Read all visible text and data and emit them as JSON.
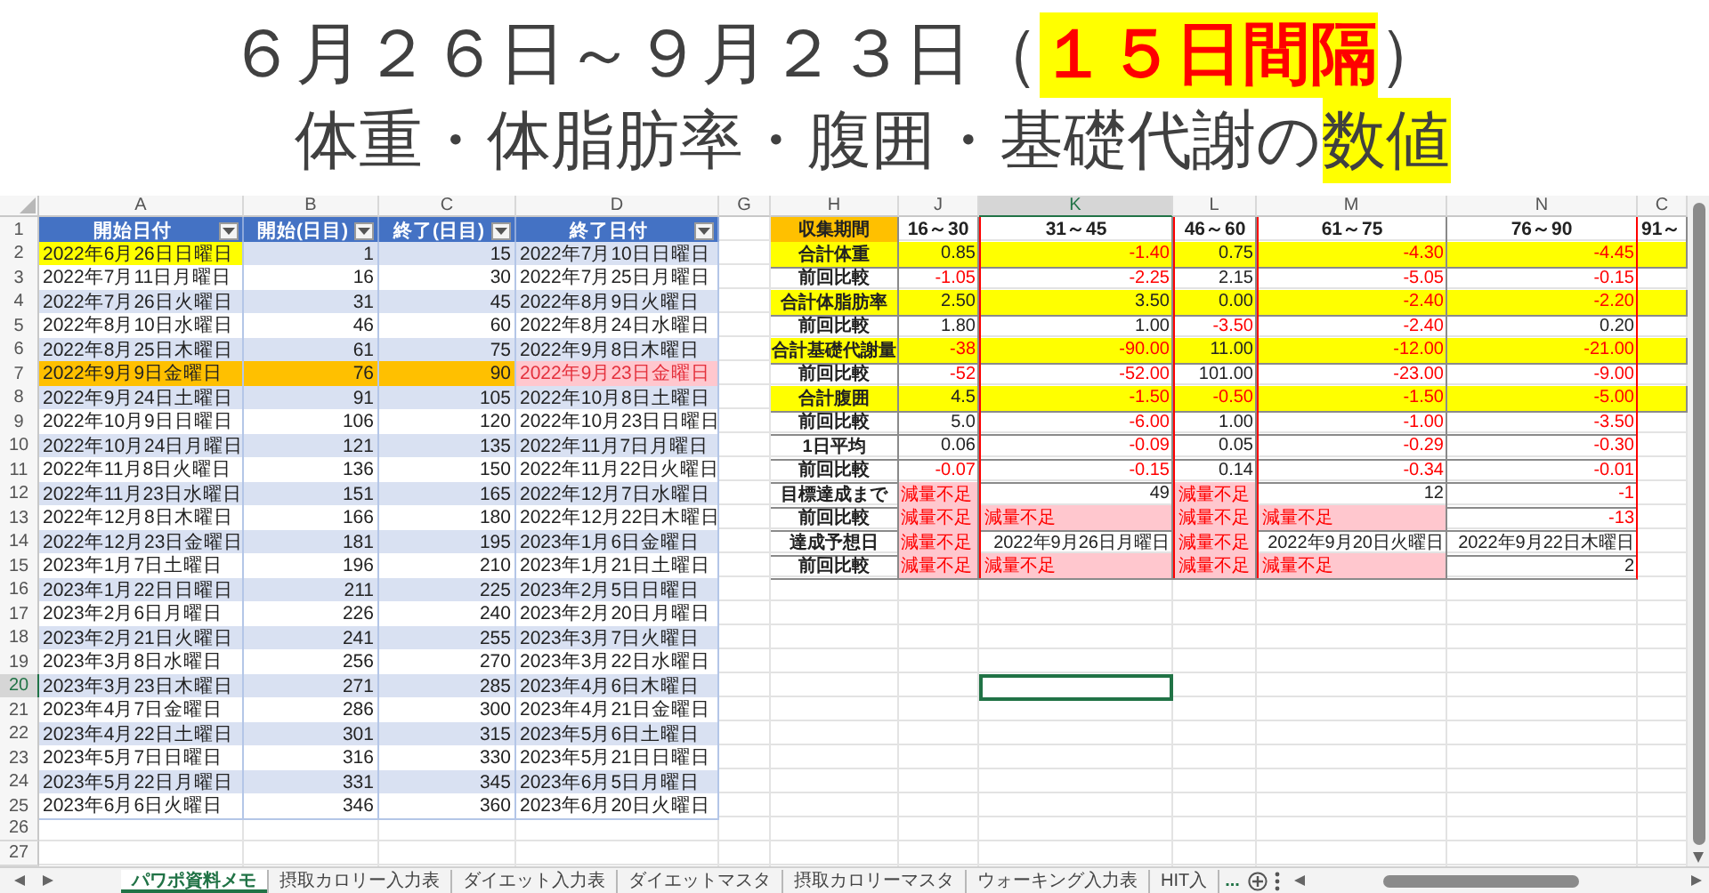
{
  "title": {
    "lines": [
      [
        {
          "text": "６月２６日～９月２３日（",
          "highlighted": false
        },
        {
          "text": "１５日間隔",
          "highlighted": true
        },
        {
          "text": "）",
          "highlighted": false
        }
      ],
      [
        {
          "text": "体重・体脂肪率・腹囲・基礎代謝の",
          "highlighted": false
        },
        {
          "text": "数値",
          "highlighted": true
        }
      ]
    ]
  },
  "sheet": {
    "column_headers": [
      {
        "label": "A",
        "selected": false
      },
      {
        "label": "B",
        "selected": false
      },
      {
        "label": "C",
        "selected": false
      },
      {
        "label": "D",
        "selected": false
      },
      {
        "label": "G",
        "selected": false
      },
      {
        "label": "H",
        "selected": false
      },
      {
        "label": "J",
        "selected": false
      },
      {
        "label": "K",
        "selected": true
      },
      {
        "label": "L",
        "selected": false
      },
      {
        "label": "M",
        "selected": false
      },
      {
        "label": "N",
        "selected": false
      },
      {
        "label": "C",
        "selected": false
      }
    ],
    "row_numbers": [
      {
        "label": "1",
        "selected": false
      },
      {
        "label": "2",
        "selected": false
      },
      {
        "label": "3",
        "selected": false
      },
      {
        "label": "4",
        "selected": false
      },
      {
        "label": "5",
        "selected": false
      },
      {
        "label": "6",
        "selected": false
      },
      {
        "label": "7",
        "selected": false
      },
      {
        "label": "8",
        "selected": false
      },
      {
        "label": "9",
        "selected": false
      },
      {
        "label": "10",
        "selected": false
      },
      {
        "label": "11",
        "selected": false
      },
      {
        "label": "12",
        "selected": false
      },
      {
        "label": "13",
        "selected": false
      },
      {
        "label": "14",
        "selected": false
      },
      {
        "label": "15",
        "selected": false
      },
      {
        "label": "16",
        "selected": false
      },
      {
        "label": "17",
        "selected": false
      },
      {
        "label": "18",
        "selected": false
      },
      {
        "label": "19",
        "selected": false
      },
      {
        "label": "20",
        "selected": true
      },
      {
        "label": "21",
        "selected": false
      },
      {
        "label": "22",
        "selected": false
      },
      {
        "label": "23",
        "selected": false
      },
      {
        "label": "24",
        "selected": false
      },
      {
        "label": "25",
        "selected": false
      },
      {
        "label": "26",
        "selected": false
      },
      {
        "label": "27",
        "selected": false
      }
    ]
  },
  "left_table": {
    "headers": [
      "開始日付",
      "開始(日目)",
      "終了(日目)",
      "終了日付"
    ],
    "rows": [
      {
        "kind": "first",
        "cells": [
          "2022年6月26日日曜日",
          "1",
          "15",
          "2022年7月10日日曜日"
        ]
      },
      {
        "kind": "normal",
        "cells": [
          "2022年7月11日月曜日",
          "16",
          "30",
          "2022年7月25日月曜日"
        ]
      },
      {
        "kind": "normal",
        "cells": [
          "2022年7月26日火曜日",
          "31",
          "45",
          "2022年8月9日火曜日"
        ]
      },
      {
        "kind": "normal",
        "cells": [
          "2022年8月10日水曜日",
          "46",
          "60",
          "2022年8月24日水曜日"
        ]
      },
      {
        "kind": "normal",
        "cells": [
          "2022年8月25日木曜日",
          "61",
          "75",
          "2022年9月8日木曜日"
        ]
      },
      {
        "kind": "current",
        "cells": [
          "2022年9月9日金曜日",
          "76",
          "90",
          "2022年9月23日金曜日"
        ]
      },
      {
        "kind": "normal",
        "cells": [
          "2022年9月24日土曜日",
          "91",
          "105",
          "2022年10月8日土曜日"
        ]
      },
      {
        "kind": "normal",
        "cells": [
          "2022年10月9日日曜日",
          "106",
          "120",
          "2022年10月23日日曜日"
        ]
      },
      {
        "kind": "normal",
        "cells": [
          "2022年10月24日月曜日",
          "121",
          "135",
          "2022年11月7日月曜日"
        ]
      },
      {
        "kind": "normal",
        "cells": [
          "2022年11月8日火曜日",
          "136",
          "150",
          "2022年11月22日火曜日"
        ]
      },
      {
        "kind": "normal",
        "cells": [
          "2022年11月23日水曜日",
          "151",
          "165",
          "2022年12月7日水曜日"
        ]
      },
      {
        "kind": "normal",
        "cells": [
          "2022年12月8日木曜日",
          "166",
          "180",
          "2022年12月22日木曜日"
        ]
      },
      {
        "kind": "normal",
        "cells": [
          "2022年12月23日金曜日",
          "181",
          "195",
          "2023年1月6日金曜日"
        ]
      },
      {
        "kind": "normal",
        "cells": [
          "2023年1月7日土曜日",
          "196",
          "210",
          "2023年1月21日土曜日"
        ]
      },
      {
        "kind": "normal",
        "cells": [
          "2023年1月22日日曜日",
          "211",
          "225",
          "2023年2月5日日曜日"
        ]
      },
      {
        "kind": "normal",
        "cells": [
          "2023年2月6日月曜日",
          "226",
          "240",
          "2023年2月20日月曜日"
        ]
      },
      {
        "kind": "normal",
        "cells": [
          "2023年2月21日火曜日",
          "241",
          "255",
          "2023年3月7日火曜日"
        ]
      },
      {
        "kind": "normal",
        "cells": [
          "2023年3月8日水曜日",
          "256",
          "270",
          "2023年3月22日水曜日"
        ]
      },
      {
        "kind": "normal",
        "cells": [
          "2023年3月23日木曜日",
          "271",
          "285",
          "2023年4月6日木曜日"
        ]
      },
      {
        "kind": "normal",
        "cells": [
          "2023年4月7日金曜日",
          "286",
          "300",
          "2023年4月21日金曜日"
        ]
      },
      {
        "kind": "normal",
        "cells": [
          "2023年4月22日土曜日",
          "301",
          "315",
          "2023年5月6日土曜日"
        ]
      },
      {
        "kind": "normal",
        "cells": [
          "2023年5月7日日曜日",
          "316",
          "330",
          "2023年5月21日日曜日"
        ]
      },
      {
        "kind": "normal",
        "cells": [
          "2023年5月22日月曜日",
          "331",
          "345",
          "2023年6月5日月曜日"
        ]
      },
      {
        "kind": "normal",
        "cells": [
          "2023年6月6日火曜日",
          "346",
          "360",
          "2023年6月20日火曜日"
        ]
      }
    ]
  },
  "right_table": {
    "corner_label": "収集期間",
    "periods": [
      "16～30",
      "31～45",
      "46～60",
      "61～75",
      "76～90",
      "91～"
    ],
    "rows": [
      {
        "label": "合計体重",
        "kind": "total",
        "cells": [
          {
            "text": "0.85",
            "kind": "value"
          },
          {
            "text": "-1.40",
            "kind": "negative"
          },
          {
            "text": "0.75",
            "kind": "value"
          },
          {
            "text": "-4.30",
            "kind": "negative"
          },
          {
            "text": "-4.45",
            "kind": "negative"
          }
        ]
      },
      {
        "label": "前回比較",
        "kind": "detail",
        "cells": [
          {
            "text": "-1.05",
            "kind": "negative"
          },
          {
            "text": "-2.25",
            "kind": "negative"
          },
          {
            "text": "2.15",
            "kind": "value"
          },
          {
            "text": "-5.05",
            "kind": "negative"
          },
          {
            "text": "-0.15",
            "kind": "negative"
          }
        ]
      },
      {
        "label": "合計体脂肪率",
        "kind": "total",
        "cells": [
          {
            "text": "2.50",
            "kind": "value"
          },
          {
            "text": "3.50",
            "kind": "value"
          },
          {
            "text": "0.00",
            "kind": "value"
          },
          {
            "text": "-2.40",
            "kind": "negative"
          },
          {
            "text": "-2.20",
            "kind": "negative"
          }
        ]
      },
      {
        "label": "前回比較",
        "kind": "detail",
        "cells": [
          {
            "text": "1.80",
            "kind": "value"
          },
          {
            "text": "1.00",
            "kind": "value"
          },
          {
            "text": "-3.50",
            "kind": "negative"
          },
          {
            "text": "-2.40",
            "kind": "negative"
          },
          {
            "text": "0.20",
            "kind": "value"
          }
        ]
      },
      {
        "label": "合計基礎代謝量",
        "kind": "total",
        "cells": [
          {
            "text": "-38",
            "kind": "negative"
          },
          {
            "text": "-90.00",
            "kind": "negative"
          },
          {
            "text": "11.00",
            "kind": "value"
          },
          {
            "text": "-12.00",
            "kind": "negative"
          },
          {
            "text": "-21.00",
            "kind": "negative"
          }
        ]
      },
      {
        "label": "前回比較",
        "kind": "detail",
        "cells": [
          {
            "text": "-52",
            "kind": "negative"
          },
          {
            "text": "-52.00",
            "kind": "negative"
          },
          {
            "text": "101.00",
            "kind": "value"
          },
          {
            "text": "-23.00",
            "kind": "negative"
          },
          {
            "text": "-9.00",
            "kind": "negative"
          }
        ]
      },
      {
        "label": "合計腹囲",
        "kind": "total",
        "cells": [
          {
            "text": "4.5",
            "kind": "value"
          },
          {
            "text": "-1.50",
            "kind": "negative"
          },
          {
            "text": "-0.50",
            "kind": "negative"
          },
          {
            "text": "-1.50",
            "kind": "negative"
          },
          {
            "text": "-5.00",
            "kind": "negative"
          }
        ]
      },
      {
        "label": "前回比較",
        "kind": "detail",
        "cells": [
          {
            "text": "5.0",
            "kind": "value"
          },
          {
            "text": "-6.00",
            "kind": "negative"
          },
          {
            "text": "1.00",
            "kind": "value"
          },
          {
            "text": "-1.00",
            "kind": "negative"
          },
          {
            "text": "-3.50",
            "kind": "negative"
          }
        ]
      },
      {
        "label": "1日平均",
        "kind": "detail",
        "cells": [
          {
            "text": "0.06",
            "kind": "value"
          },
          {
            "text": "-0.09",
            "kind": "negative"
          },
          {
            "text": "0.05",
            "kind": "value"
          },
          {
            "text": "-0.29",
            "kind": "negative"
          },
          {
            "text": "-0.30",
            "kind": "negative"
          }
        ]
      },
      {
        "label": "前回比較",
        "kind": "detail",
        "cells": [
          {
            "text": "-0.07",
            "kind": "negative"
          },
          {
            "text": "-0.15",
            "kind": "negative"
          },
          {
            "text": "0.14",
            "kind": "value"
          },
          {
            "text": "-0.34",
            "kind": "negative"
          },
          {
            "text": "-0.01",
            "kind": "negative"
          }
        ]
      },
      {
        "label": "目標達成まで",
        "kind": "detail",
        "cells": [
          {
            "text": "減量不足",
            "kind": "shortfall"
          },
          {
            "text": "49",
            "kind": "value"
          },
          {
            "text": "減量不足",
            "kind": "shortfall"
          },
          {
            "text": "12",
            "kind": "value"
          },
          {
            "text": "-1",
            "kind": "negative"
          }
        ]
      },
      {
        "label": "前回比較",
        "kind": "detail",
        "cells": [
          {
            "text": "減量不足",
            "kind": "shortfall"
          },
          {
            "text": "減量不足",
            "kind": "shortfall"
          },
          {
            "text": "減量不足",
            "kind": "shortfall"
          },
          {
            "text": "減量不足",
            "kind": "shortfall"
          },
          {
            "text": "-13",
            "kind": "negative"
          }
        ]
      },
      {
        "label": "達成予想日",
        "kind": "detail",
        "cells": [
          {
            "text": "減量不足",
            "kind": "shortfall"
          },
          {
            "text": "2022年9月26日月曜日",
            "kind": "value"
          },
          {
            "text": "減量不足",
            "kind": "shortfall"
          },
          {
            "text": "2022年9月20日火曜日",
            "kind": "value"
          },
          {
            "text": "2022年9月22日木曜日",
            "kind": "value"
          }
        ]
      },
      {
        "label": "前回比較",
        "kind": "detail",
        "cells": [
          {
            "text": "減量不足",
            "kind": "shortfall"
          },
          {
            "text": "減量不足",
            "kind": "shortfall"
          },
          {
            "text": "減量不足",
            "kind": "shortfall"
          },
          {
            "text": "減量不足",
            "kind": "shortfall"
          },
          {
            "text": "2",
            "kind": "value"
          }
        ]
      }
    ]
  },
  "sheet_tabs": [
    {
      "label": "パワポ資料メモ",
      "selected": true
    },
    {
      "label": "摂取カロリー入力表",
      "selected": false
    },
    {
      "label": "ダイエット入力表",
      "selected": false
    },
    {
      "label": "ダイエットマスタ",
      "selected": false
    },
    {
      "label": "摂取カロリーマスタ",
      "selected": false
    },
    {
      "label": "ウォーキング入力表",
      "selected": false
    },
    {
      "label": "HIT入",
      "selected": false
    }
  ],
  "more_tabs_label": "..."
}
